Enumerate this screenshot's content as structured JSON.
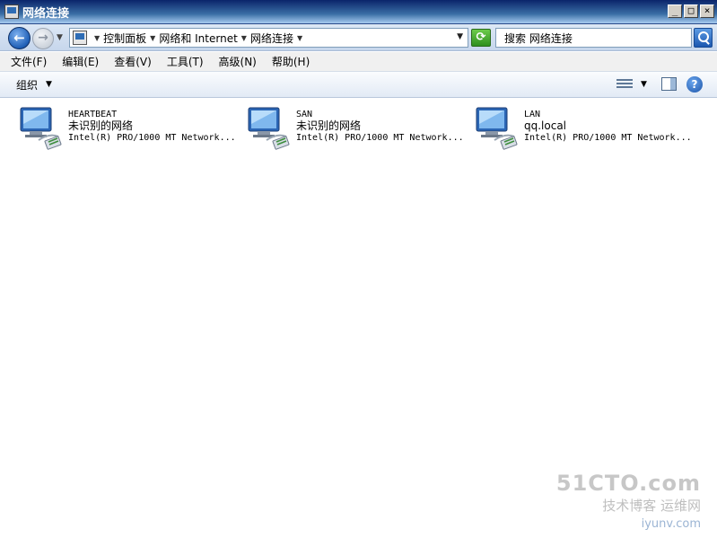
{
  "window": {
    "title": "网络连接",
    "controls": [
      "_",
      "□",
      "×"
    ]
  },
  "nav": {
    "back_symbol": "←",
    "forward_symbol": "→",
    "breadcrumbs": [
      "控制面板",
      "网络和 Internet",
      "网络连接"
    ],
    "refresh_symbol": "⟳",
    "search_placeholder": "搜索 网络连接"
  },
  "menu": [
    "文件(F)",
    "编辑(E)",
    "查看(V)",
    "工具(T)",
    "高级(N)",
    "帮助(H)"
  ],
  "toolbar": {
    "organize_label": "组织",
    "help_symbol": "?"
  },
  "connections": [
    {
      "name": "HEARTBEAT",
      "status": "未识别的网络",
      "device": "Intel(R) PRO/1000 MT Network..."
    },
    {
      "name": "SAN",
      "status": "未识别的网络",
      "device": "Intel(R) PRO/1000 MT Network..."
    },
    {
      "name": "LAN",
      "status": "qq.local",
      "device": "Intel(R) PRO/1000 MT Network..."
    }
  ],
  "watermark": {
    "line1": "51CTO.com",
    "line2": "技术博客",
    "line2b": "运维网",
    "line3": "iyunv.com"
  },
  "icons": {
    "connection": "network-connection-icon",
    "search": "search-icon",
    "help": "help-icon"
  }
}
